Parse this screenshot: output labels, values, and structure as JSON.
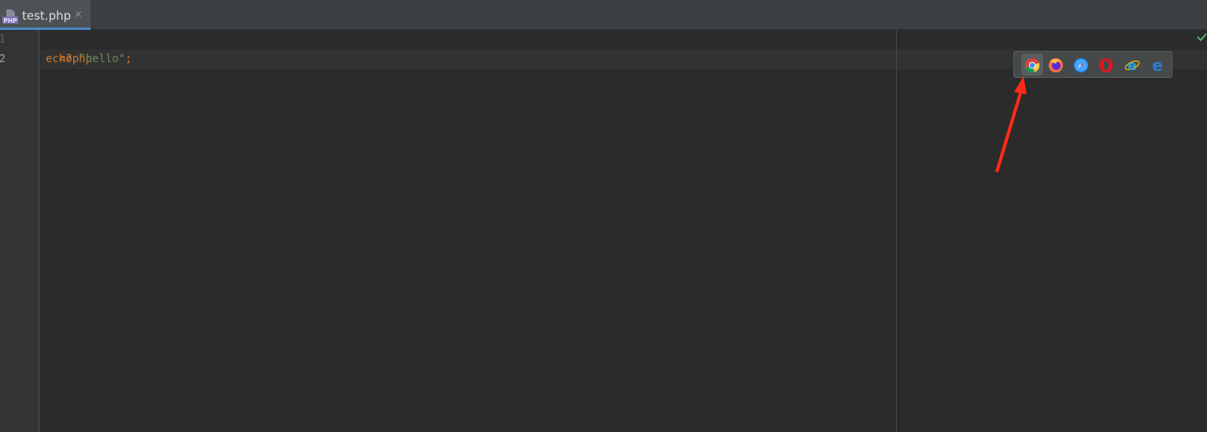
{
  "tab": {
    "file_name": "test.php",
    "file_type_icon": "php-file-icon",
    "close_symbol": "×"
  },
  "editor": {
    "line_numbers": [
      "1",
      "2"
    ],
    "lines": [
      {
        "tokens": [
          {
            "text": "<?php",
            "kind": "keyword"
          }
        ]
      },
      {
        "tokens": [
          {
            "text": "echo",
            "kind": "keyword"
          },
          {
            "text": " ",
            "kind": "plain"
          },
          {
            "text": "\"hello\"",
            "kind": "string"
          },
          {
            "text": ";",
            "kind": "keyword"
          }
        ]
      }
    ],
    "current_line": 2,
    "inspection_status_icon": "checkmark-icon"
  },
  "browser_toolbar": {
    "icons": [
      "chrome-icon",
      "firefox-icon",
      "safari-icon",
      "opera-icon",
      "internet-explorer-icon",
      "edge-icon"
    ],
    "highlighted": "chrome-icon"
  },
  "annotation": {
    "icon": "red-arrow-icon",
    "color": "#ff2a1a"
  },
  "colors": {
    "background": "#2b2b2b",
    "gutter": "#313335",
    "keyword": "#cc7832",
    "string": "#6a8759",
    "tab_underline": "#4a88c7",
    "check": "#59a869"
  }
}
